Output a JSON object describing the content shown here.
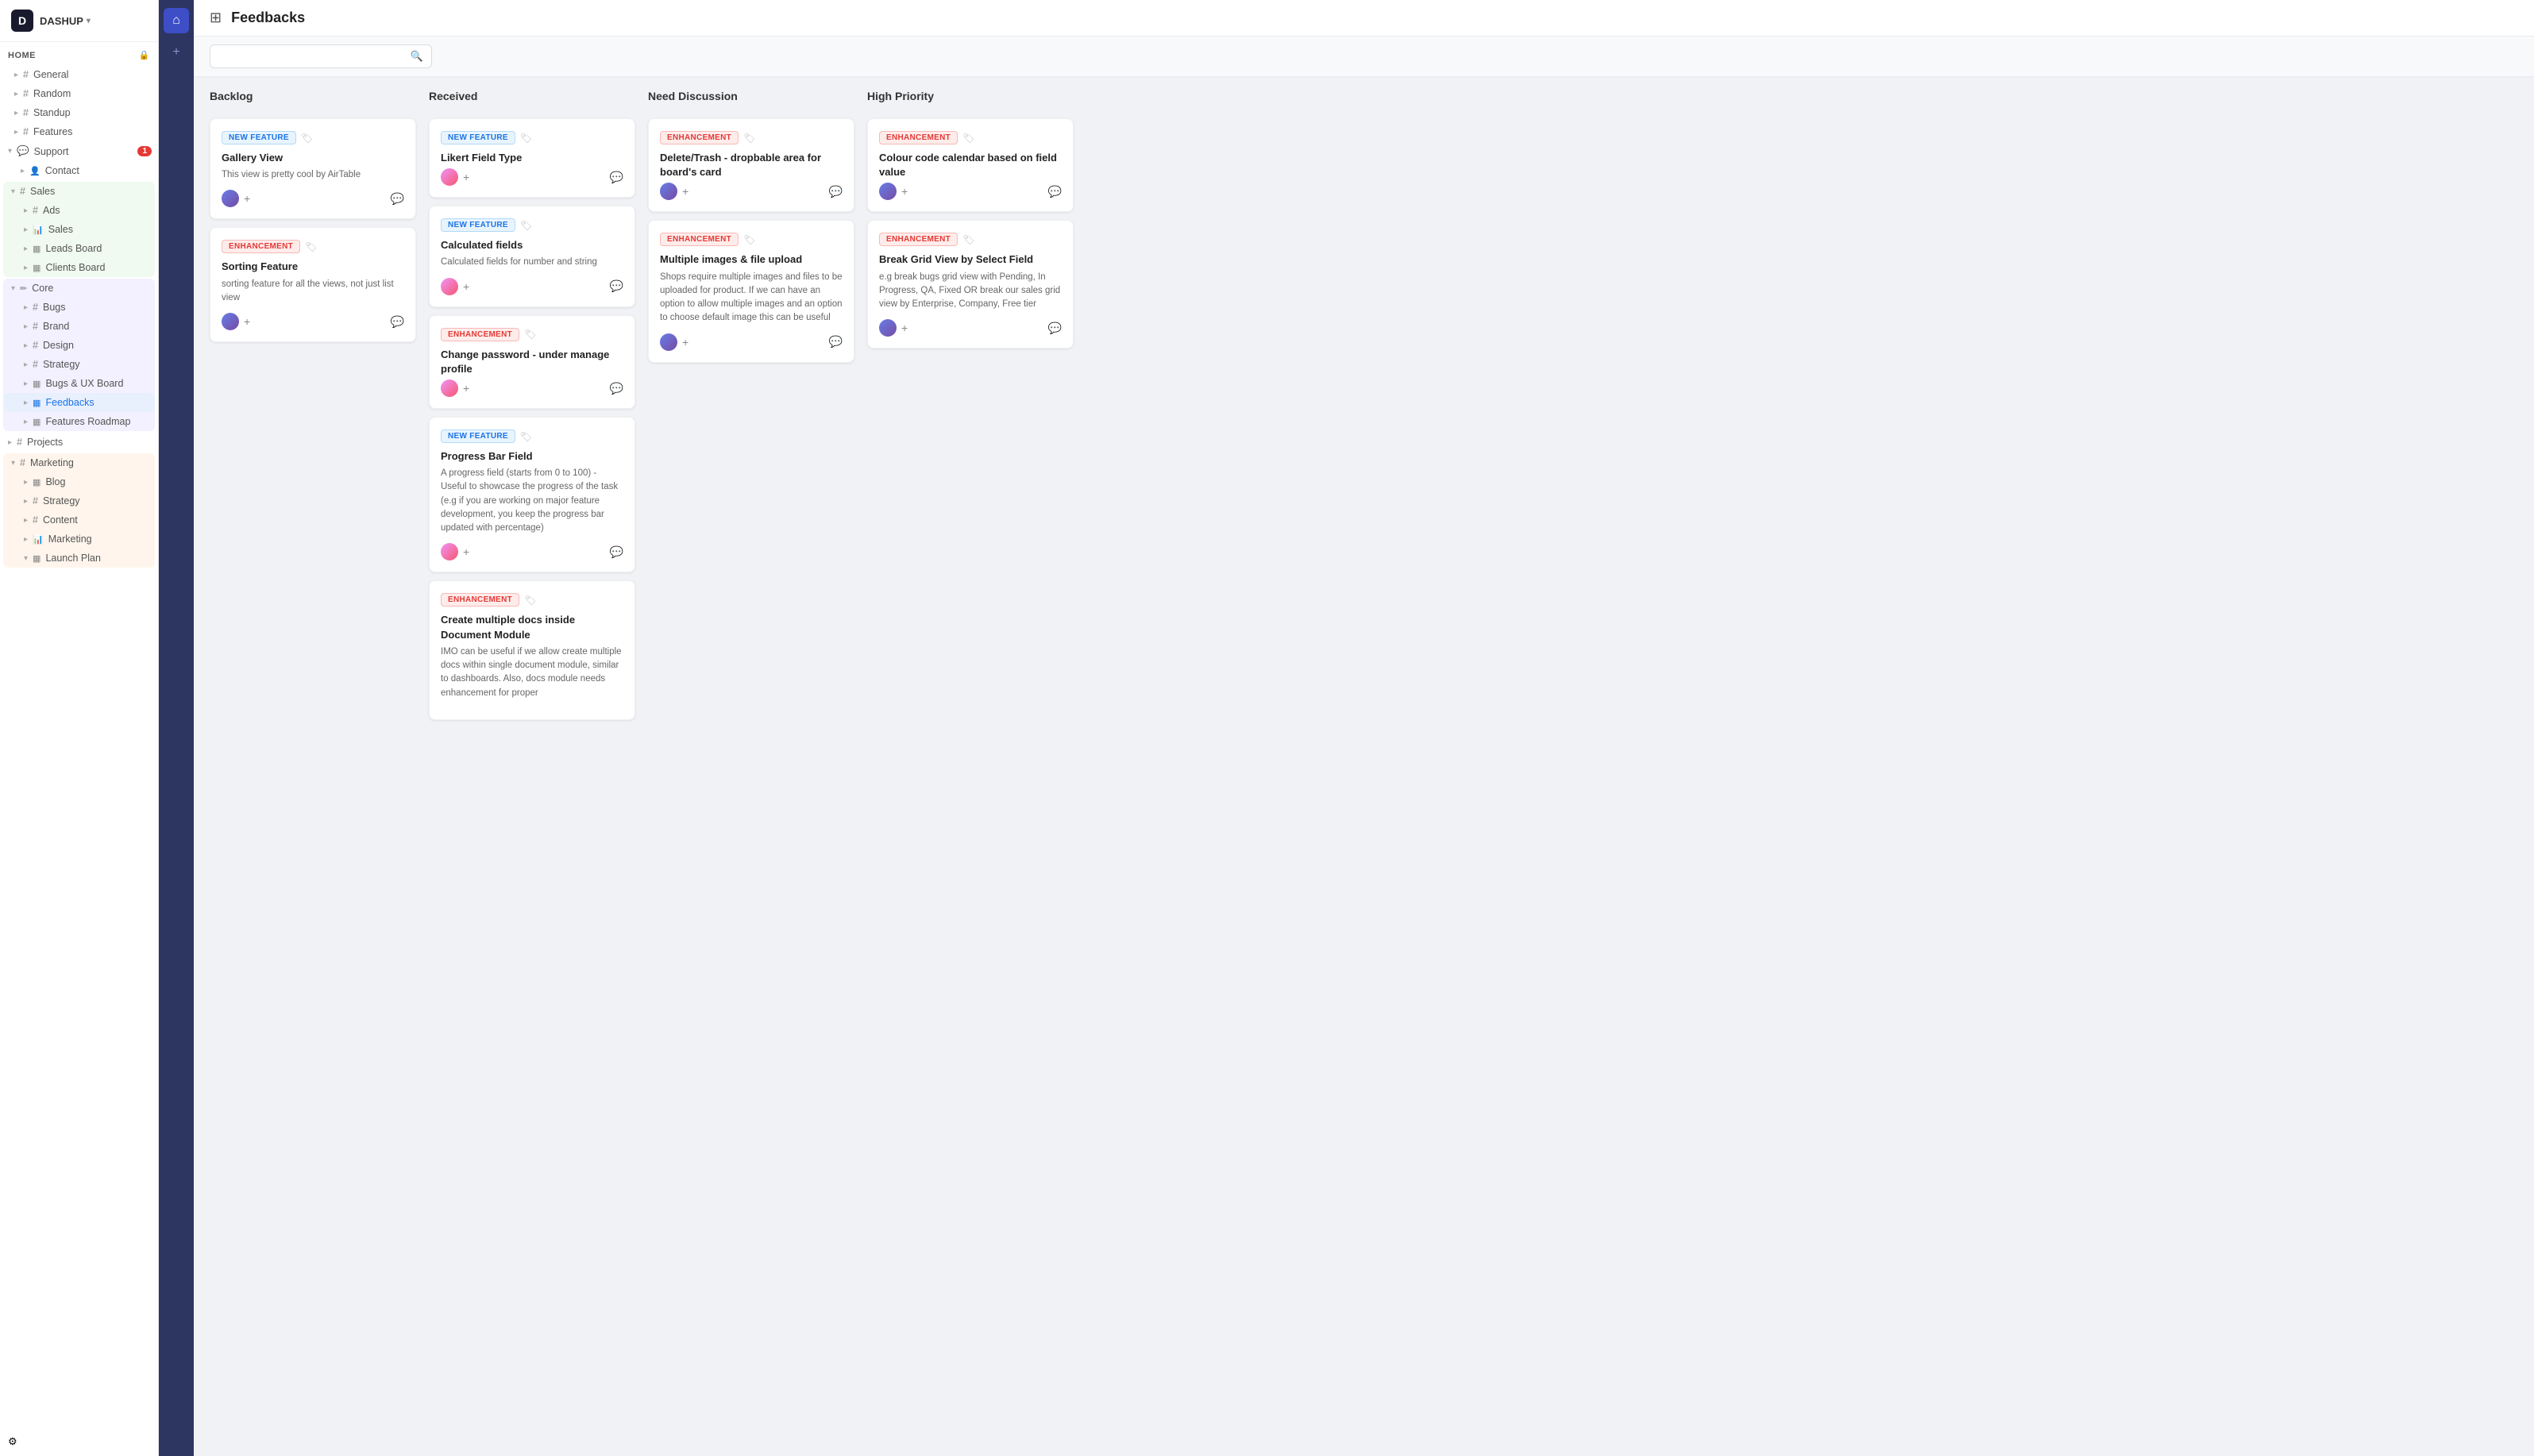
{
  "app": {
    "logo": "D",
    "workspace": "DASHUP",
    "workspace_chevron": "▾"
  },
  "sidebar": {
    "home_label": "HOME",
    "add_icon": "+",
    "settings_icon": "⚙",
    "channels": [
      {
        "id": "general",
        "icon": "#",
        "label": "General",
        "indent": 1
      },
      {
        "id": "random",
        "icon": "#",
        "label": "Random",
        "indent": 1
      },
      {
        "id": "standup",
        "icon": "#",
        "label": "Standup",
        "indent": 1
      },
      {
        "id": "features",
        "icon": "#",
        "label": "Features",
        "indent": 1
      }
    ],
    "support_group": {
      "label": "Support",
      "badge": "1",
      "children": [
        {
          "id": "contact",
          "icon": "👤",
          "label": "Contact",
          "indent": 2
        }
      ]
    },
    "sales_group": {
      "label": "Sales",
      "children": [
        {
          "id": "ads",
          "icon": "#",
          "label": "Ads",
          "indent": 2
        },
        {
          "id": "sales",
          "icon": "📊",
          "label": "Sales",
          "indent": 2
        },
        {
          "id": "leads-board",
          "icon": "▦",
          "label": "Leads Board",
          "indent": 2
        },
        {
          "id": "clients-board",
          "icon": "▦",
          "label": "Clients Board",
          "indent": 2
        }
      ]
    },
    "core_group": {
      "label": "Core",
      "children": [
        {
          "id": "bugs",
          "icon": "#",
          "label": "Bugs",
          "indent": 2
        },
        {
          "id": "brand",
          "icon": "#",
          "label": "Brand",
          "indent": 2
        },
        {
          "id": "design",
          "icon": "#",
          "label": "Design",
          "indent": 2
        },
        {
          "id": "strategy",
          "icon": "#",
          "label": "Strategy",
          "indent": 2
        },
        {
          "id": "bugs-ux-board",
          "icon": "▦",
          "label": "Bugs & UX Board",
          "indent": 2
        },
        {
          "id": "feedbacks",
          "icon": "▦",
          "label": "Feedbacks",
          "indent": 2,
          "active": true
        },
        {
          "id": "features-roadmap",
          "icon": "▦",
          "label": "Features Roadmap",
          "indent": 2
        }
      ]
    },
    "projects_group": {
      "label": "Projects",
      "icon": "#"
    },
    "marketing_group": {
      "label": "Marketing",
      "children": [
        {
          "id": "blog",
          "icon": "▦",
          "label": "Blog",
          "indent": 2
        },
        {
          "id": "strategy-mkt",
          "icon": "#",
          "label": "Strategy",
          "indent": 2
        },
        {
          "id": "content",
          "icon": "#",
          "label": "Content",
          "indent": 2
        },
        {
          "id": "marketing-item",
          "icon": "📊",
          "label": "Marketing",
          "indent": 2
        },
        {
          "id": "launch-plan",
          "icon": "▦",
          "label": "Launch Plan",
          "indent": 2
        }
      ]
    }
  },
  "page": {
    "title": "Feedbacks",
    "icon": "⊞"
  },
  "search": {
    "placeholder": ""
  },
  "columns": [
    {
      "id": "backlog",
      "title": "Backlog",
      "cards": [
        {
          "id": "gallery-view",
          "badge_type": "new_feature",
          "badge_label": "NEW FEATURE",
          "title": "Gallery View",
          "desc": "This view is pretty cool by AirTable",
          "has_avatar": true,
          "avatar_type": "1"
        },
        {
          "id": "sorting-feature",
          "badge_type": "enhancement",
          "badge_label": "ENHANCEMENT",
          "title": "Sorting Feature",
          "desc": "sorting feature for all the views, not just list view",
          "has_avatar": true,
          "avatar_type": "1"
        }
      ]
    },
    {
      "id": "received",
      "title": "Received",
      "cards": [
        {
          "id": "likert-field-type",
          "badge_type": "new_feature",
          "badge_label": "NEW FEATURE",
          "title": "Likert Field Type",
          "desc": "",
          "has_avatar": true,
          "avatar_type": "2"
        },
        {
          "id": "calculated-fields",
          "badge_type": "new_feature",
          "badge_label": "NEW FEATURE",
          "title": "Calculated fields",
          "desc": "Calculated fields for number and string",
          "has_avatar": true,
          "avatar_type": "2"
        },
        {
          "id": "change-password",
          "badge_type": "enhancement",
          "badge_label": "ENHANCEMENT",
          "title": "Change password - under manage profile",
          "desc": "",
          "has_avatar": true,
          "avatar_type": "2"
        },
        {
          "id": "progress-bar-field",
          "badge_type": "new_feature",
          "badge_label": "NEW FEATURE",
          "title": "Progress Bar Field",
          "desc": "A progress field (starts from 0 to 100) - Useful to showcase the progress of the task (e.g if you are working on major feature development, you keep the progress bar updated with percentage)",
          "has_avatar": true,
          "avatar_type": "2"
        },
        {
          "id": "create-multiple-docs",
          "badge_type": "enhancement",
          "badge_label": "ENHANCEMENT",
          "title": "Create multiple docs inside Document Module",
          "desc": "IMO can be useful if we allow create multiple docs within single document module, similar to dashboards. Also, docs module needs enhancement for proper",
          "has_avatar": false,
          "avatar_type": "2"
        }
      ]
    },
    {
      "id": "need-discussion",
      "title": "Need Discussion",
      "cards": [
        {
          "id": "delete-trash",
          "badge_type": "enhancement",
          "badge_label": "ENHANCEMENT",
          "title": "Delete/Trash - dropbable area for board's card",
          "desc": "",
          "has_avatar": true,
          "avatar_type": "1"
        },
        {
          "id": "multiple-images",
          "badge_type": "enhancement",
          "badge_label": "ENHANCEMENT",
          "title": "Multiple images & file upload",
          "desc": "Shops require multiple images and files to be uploaded for product. If we can have an option to allow multiple images and an option to choose default image this can be useful",
          "has_avatar": true,
          "avatar_type": "1"
        }
      ]
    },
    {
      "id": "high-priority",
      "title": "High Priority",
      "cards": [
        {
          "id": "colour-code-calendar",
          "badge_type": "enhancement",
          "badge_label": "ENHANCEMENT",
          "title": "Colour code calendar based on field value",
          "desc": "",
          "has_avatar": true,
          "avatar_type": "1"
        },
        {
          "id": "break-grid-view",
          "badge_type": "enhancement",
          "badge_label": "ENHANCEMENT",
          "title": "Break Grid View by Select Field",
          "desc": "e.g break bugs grid view with Pending, In Progress, QA, Fixed OR break our sales grid view by Enterprise, Company, Free tier",
          "has_avatar": true,
          "avatar_type": "1"
        }
      ]
    }
  ]
}
